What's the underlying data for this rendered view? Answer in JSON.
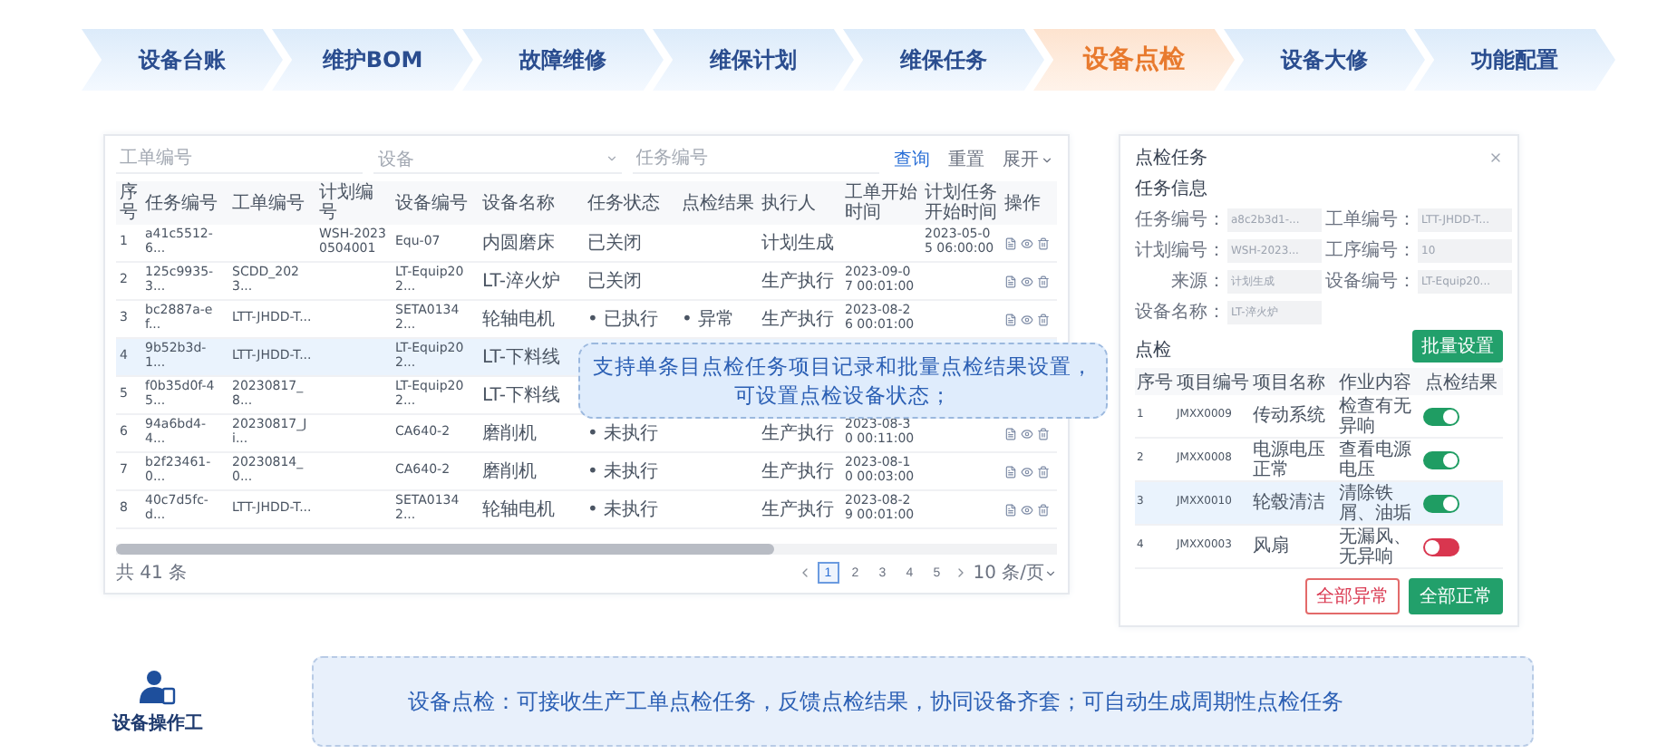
{
  "tabs": [
    {
      "label": "设备台账",
      "selected": false
    },
    {
      "label": "维护BOM",
      "selected": false
    },
    {
      "label": "故障维修",
      "selected": false
    },
    {
      "label": "维保计划",
      "selected": false
    },
    {
      "label": "维保任务",
      "selected": false
    },
    {
      "label": "设备点检",
      "selected": true
    },
    {
      "label": "设备大修",
      "selected": false
    },
    {
      "label": "功能配置",
      "selected": false
    }
  ],
  "task_list": {
    "filters": [
      {
        "placeholder": "工单编号",
        "kind": "input"
      },
      {
        "placeholder": "设备",
        "kind": "select"
      },
      {
        "placeholder": "任务编号",
        "kind": "input"
      }
    ],
    "actions": [
      {
        "label": "查询",
        "kind": "primary"
      },
      {
        "label": "重置",
        "kind": "link"
      },
      {
        "label": "展开",
        "kind": "expand"
      }
    ],
    "columns": [
      "序号",
      "任务编号",
      "工单编号",
      "计划编号",
      "设备编号",
      "设备名称",
      "任务状态",
      "点检结果",
      "执行人",
      "工单开始时间",
      "计划任务开始时间",
      "操作"
    ],
    "rows": [
      {
        "selected": false,
        "cells": [
          "1",
          "a41c5512-6...",
          "",
          "WSH-20230504001",
          "Equ-07",
          "内圆磨床",
          "已关闭",
          "",
          "计划生成",
          "",
          "2023-05-05 06:00:00"
        ]
      },
      {
        "selected": false,
        "cells": [
          "2",
          "125c9935-3...",
          "SCDD_2023...",
          "",
          "LT-Equip202...",
          "LT-淬火炉",
          "已关闭",
          "",
          "生产执行",
          "2023-09-07 00:01:00",
          ""
        ]
      },
      {
        "selected": false,
        "cells": [
          "3",
          "bc2887a-ef...",
          "LTT-JHDD-T...",
          "",
          "SETA01342...",
          "轮轴电机",
          "• 已执行",
          "• 异常",
          "生产执行",
          "2023-08-26 00:01:00",
          ""
        ]
      },
      {
        "selected": true,
        "cells": [
          "4",
          "9b52b3d-1...",
          "LTT-JHDD-T...",
          "",
          "LT-Equip202...",
          "LT-下料线"
        ]
      },
      {
        "selected": false,
        "cells": [
          "5",
          "f0b35d0f-45...",
          "20230817_8...",
          "",
          "LT-Equip202...",
          "LT-下料线"
        ]
      },
      {
        "selected": false,
        "cells": [
          "6",
          "94a6bd4-4...",
          "20230817_Ji...",
          "",
          "CA640-2",
          "磨削机",
          "• 未执行",
          "",
          "生产执行",
          "2023-08-30 00:11:00",
          ""
        ]
      },
      {
        "selected": false,
        "cells": [
          "7",
          "b2f23461-0...",
          "20230814_0...",
          "",
          "CA640-2",
          "磨削机",
          "• 未执行",
          "",
          "生产执行",
          "2023-08-10 00:03:00",
          ""
        ]
      },
      {
        "selected": false,
        "cells": [
          "8",
          "40c7d5fc-d...",
          "LTT-JHDD-T...",
          "",
          "SETA01342...",
          "轮轴电机",
          "• 未执行",
          "",
          "生产执行",
          "2023-08-29 00:01:00",
          ""
        ]
      }
    ],
    "total": "共 41 条",
    "pages": [
      {
        "label": "1",
        "selected": true
      },
      {
        "label": "2",
        "selected": false
      },
      {
        "label": "3",
        "selected": false
      },
      {
        "label": "4",
        "selected": false
      },
      {
        "label": "5",
        "selected": false
      }
    ],
    "page_size": "10 条/页"
  },
  "callout": {
    "lines": [
      "支持单条目点检任务项目记录和批量点检结果设置，",
      "可设置点检设备状态；"
    ]
  },
  "dialog": {
    "title": "点检任务",
    "section": "任务信息",
    "fields": [
      {
        "label": "任务编号：",
        "value": "a8c2b3d1-..."
      },
      {
        "label": "工单编号：",
        "value": "LTT-JHDD-T..."
      },
      {
        "label": "计划编号：",
        "value": "WSH-2023..."
      },
      {
        "label": "工序编号：",
        "value": "10"
      },
      {
        "label": "来源：",
        "value": "计划生成"
      },
      {
        "label": "设备编号：",
        "value": "LT-Equip20..."
      },
      {
        "label": "设备名称：",
        "value": "LT-淬火炉"
      }
    ],
    "check_title": "点检",
    "batch_button": "批量设置",
    "columns": [
      "序号",
      "项目编号",
      "项目名称",
      "作业内容",
      "点检结果"
    ],
    "items": [
      {
        "cells": [
          "1",
          "JMXX0009",
          "传动系统",
          "检查有无异响"
        ],
        "ok": true,
        "selected": false
      },
      {
        "cells": [
          "2",
          "JMXX0008",
          "电源电压正常",
          "查看电源电压"
        ],
        "ok": true,
        "selected": false
      },
      {
        "cells": [
          "3",
          "JMXX0010",
          "轮毂清洁",
          "清除铁屑、油垢"
        ],
        "ok": true,
        "selected": true
      },
      {
        "cells": [
          "4",
          "JMXX0003",
          "风扇",
          "无漏风、无异响"
        ],
        "ok": false,
        "selected": false
      }
    ],
    "buttons": [
      {
        "label": "全部异常",
        "kind": "danger"
      },
      {
        "label": "全部正常",
        "kind": "primary"
      }
    ]
  },
  "role": {
    "label": "设备操作工"
  },
  "banner": {
    "text": "设备点检：可接收生产工单点检任务，反馈点检结果，协同设备齐套；可自动生成周期性点检任务"
  }
}
